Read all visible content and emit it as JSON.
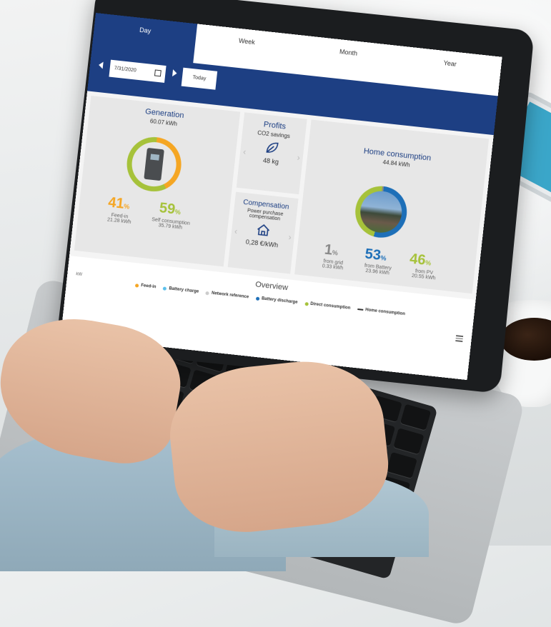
{
  "tabs": [
    {
      "label": "Day",
      "active": true
    },
    {
      "label": "Week",
      "active": false
    },
    {
      "label": "Month",
      "active": false
    },
    {
      "label": "Year",
      "active": false
    }
  ],
  "date": {
    "value": "7/31/2020",
    "today_label": "Today"
  },
  "generation": {
    "title": "Generation",
    "total": "60.07 kWh",
    "feed_in": {
      "value": "41",
      "unit": "%",
      "label": "Feed-in",
      "amount": "21.28 kWh"
    },
    "self_consumption": {
      "value": "59",
      "unit": "%",
      "label": "Self consumption",
      "amount": "35.79 kWh"
    }
  },
  "profits": {
    "title": "Profits",
    "subtitle": "CO2 savings",
    "value": "48 kg",
    "icon": "leaf-icon"
  },
  "compensation": {
    "title": "Compensation",
    "subtitle": "Power purchase compensation",
    "value": "0,28",
    "unit": "€/kWh",
    "icon": "house-icon"
  },
  "home_consumption": {
    "title": "Home consumption",
    "total": "44.84 kWh",
    "from_grid": {
      "value": "1",
      "unit": "%",
      "label": "from grid",
      "amount": "0.33 kWh"
    },
    "from_battery": {
      "value": "53",
      "unit": "%",
      "label": "from Battery",
      "amount": "23.96 kWh"
    },
    "from_pv": {
      "value": "46",
      "unit": "%",
      "label": "from PV",
      "amount": "20.55 kWh"
    }
  },
  "overview": {
    "title": "Overview",
    "axis_label": "kW",
    "legend": [
      {
        "label": "Feed-in",
        "color": "#f5a623"
      },
      {
        "label": "Battery charge",
        "color": "#5bc0eb"
      },
      {
        "label": "Network reference",
        "color": "#cccccc"
      },
      {
        "label": "Battery discharge",
        "color": "#1d6fb8"
      },
      {
        "label": "Direct consumption",
        "color": "#a6c23a"
      },
      {
        "label": "Home consumption",
        "color": "#333333"
      }
    ]
  },
  "colors": {
    "primary": "#1d3f83",
    "feed_in": "#f5a623",
    "self": "#a6c23a",
    "battery": "#1d6fb8",
    "grid": "#888888"
  }
}
